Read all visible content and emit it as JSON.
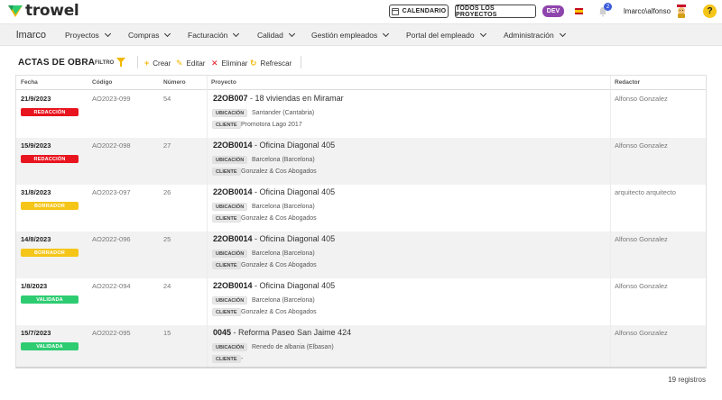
{
  "app": {
    "logo_text": "trowel"
  },
  "topbar": {
    "calendar_label": "CALENDARIO",
    "all_projects_label": "TODOS LOS PROYECTOS",
    "env_badge": "DEV",
    "notification_count": "2",
    "username": "lmarco\\alfonso",
    "help_label": "?"
  },
  "nav": {
    "brand": "lmarco",
    "items": [
      {
        "label": "Proyectos"
      },
      {
        "label": "Compras"
      },
      {
        "label": "Facturación"
      },
      {
        "label": "Calidad"
      },
      {
        "label": "Gestión empleados"
      },
      {
        "label": "Portal del empleado"
      },
      {
        "label": "Administración"
      }
    ]
  },
  "toolbar": {
    "title": "ACTAS DE OBRA",
    "filter_label": "FILTRO",
    "create_label": "Crear",
    "edit_label": "Editar",
    "delete_label": "Eliminar",
    "refresh_label": "Refrescar"
  },
  "table": {
    "headers": {
      "fecha": "Fecha",
      "codigo": "Código",
      "numero": "Número",
      "proyecto": "Proyecto",
      "redactor": "Redactor"
    },
    "tag_labels": {
      "ubicacion": "UBICACIÓN",
      "cliente": "CLIENTE"
    },
    "status_colors": {
      "REDACCIÓN": "#e8141e",
      "BORRADOR": "#f5c518",
      "VALIDADA": "#2ecc71"
    },
    "rows": [
      {
        "fecha": "21/9/2023",
        "status": "REDACCIÓN",
        "codigo": "AO2023-099",
        "numero": "54",
        "proj_code": "22OB007",
        "proj_name": " - 18 viviendas en Miramar",
        "ubicacion": "Santander (Cantabria)",
        "cliente": "Promotora Lago 2017",
        "redactor": "Alfonso Gonzalez"
      },
      {
        "fecha": "15/9/2023",
        "status": "REDACCIÓN",
        "codigo": "AO2022-098",
        "numero": "27",
        "proj_code": "22OB0014",
        "proj_name": " - Oficina Diagonal 405",
        "ubicacion": "Barcelona (Barcelona)",
        "cliente": "Gonzalez & Cos Abogados",
        "redactor": "Alfonso Gonzalez"
      },
      {
        "fecha": "31/8/2023",
        "status": "BORRADOR",
        "codigo": "AO2023-097",
        "numero": "26",
        "proj_code": "22OB0014",
        "proj_name": " - Oficina Diagonal 405",
        "ubicacion": "Barcelona (Barcelona)",
        "cliente": "Gonzalez & Cos Abogados",
        "redactor": "arquitecto arquitecto"
      },
      {
        "fecha": "14/8/2023",
        "status": "BORRADOR",
        "codigo": "AO2022-096",
        "numero": "25",
        "proj_code": "22OB0014",
        "proj_name": " - Oficina Diagonal 405",
        "ubicacion": "Barcelona (Barcelona)",
        "cliente": "Gonzalez & Cos Abogados",
        "redactor": "Alfonso Gonzalez"
      },
      {
        "fecha": "1/8/2023",
        "status": "VALIDADA",
        "codigo": "AO2022-094",
        "numero": "24",
        "proj_code": "22OB0014",
        "proj_name": " - Oficina Diagonal 405",
        "ubicacion": "Barcelona (Barcelona)",
        "cliente": "Gonzalez & Cos Abogados",
        "redactor": "Alfonso Gonzalez"
      },
      {
        "fecha": "15/7/2023",
        "status": "VALIDADA",
        "codigo": "AO2022-095",
        "numero": "15",
        "proj_code": "0045",
        "proj_name": " - Reforma Paseo San Jaime 424",
        "ubicacion": "Renedo de albania (Elbasan)",
        "cliente": "-",
        "redactor": "Alfonso Gonzalez"
      }
    ]
  },
  "footer": {
    "count_label": "19 registros"
  }
}
